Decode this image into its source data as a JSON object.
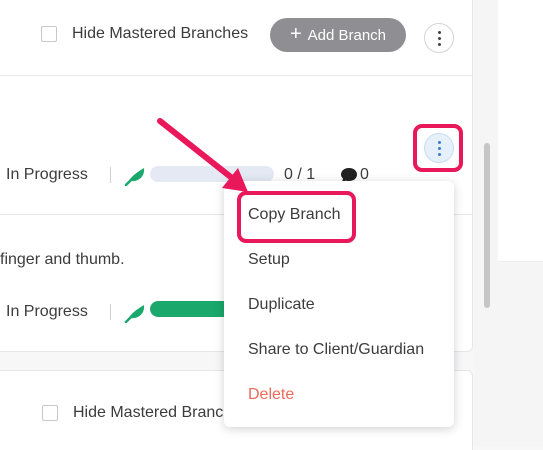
{
  "top_bar": {
    "hide_mastered_label": "Hide Mastered Branches",
    "add_branch_label": "Add Branch"
  },
  "branch_1": {
    "status": "In Progress",
    "progress_fraction": 0.0,
    "progress_text": "0 / 1",
    "comment_count": "0"
  },
  "branch_2": {
    "description": "finger and thumb.",
    "status": "In Progress",
    "progress_fraction": 1.0
  },
  "bottom_bar": {
    "hide_mastered_label": "Hide Mastered Branc"
  },
  "menu": {
    "items": [
      {
        "label": "Copy Branch"
      },
      {
        "label": "Setup"
      },
      {
        "label": "Duplicate"
      },
      {
        "label": "Share to Client/Guardian"
      },
      {
        "label": "Delete"
      }
    ]
  },
  "colors": {
    "highlight": "#e8185b",
    "progress_green": "#1aa86c",
    "delete_red": "#ef6a5a"
  }
}
